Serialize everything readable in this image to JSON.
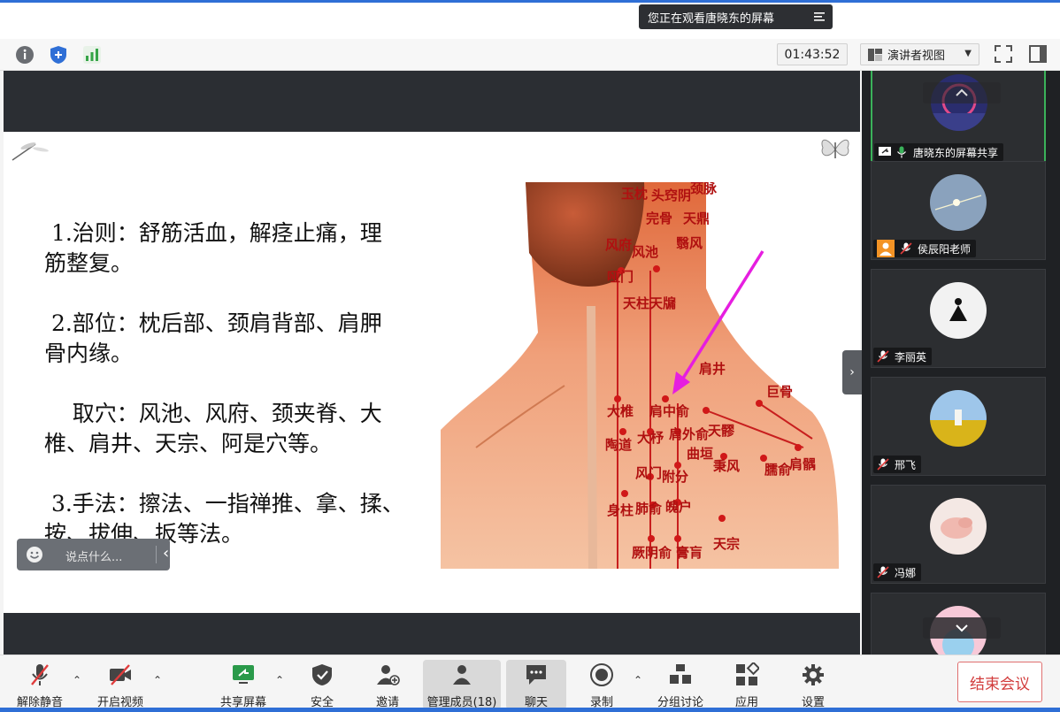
{
  "banner": {
    "text": "您正在观看唐晓东的屏幕"
  },
  "info_bar": {
    "timer": "01:43:52",
    "view_mode": "演讲者视图"
  },
  "slide": {
    "lines": [
      " 1.治则：舒筋活血，解痉止痛，理",
      "筋整复。",
      "",
      " 2.部位：枕后部、颈肩背部、肩胛",
      "骨内缘。",
      "",
      "    取穴：风池、风府、颈夹脊、大",
      "椎、肩井、天宗、阿是穴等。",
      "",
      " 3.手法：擦法、一指禅推、拿、揉、",
      "按、拔伸、扳等法。"
    ],
    "acupoints": [
      "玉枕",
      "头窍阴",
      "完骨",
      "翳风",
      "风府",
      "风池",
      "哑门",
      "天柱",
      "天牖",
      "天鼎",
      "肩井",
      "巨骨",
      "大椎",
      "肩中俞",
      "天髎",
      "陶道",
      "大杼",
      "肩外俞",
      "曲垣",
      "秉风",
      "臑俞",
      "肩髃",
      "风门",
      "附分",
      "身柱",
      "肺俞",
      "魄户",
      "厥阴俞",
      "膏肓",
      "天宗",
      "颈脉"
    ]
  },
  "chat": {
    "placeholder": "说点什么..."
  },
  "gallery": {
    "tiles": [
      {
        "name": "唐晓东的屏幕共享",
        "mic": "on",
        "sharing": true
      },
      {
        "name": "侯辰阳老师",
        "mic": "muted",
        "host": true
      },
      {
        "name": "李丽英",
        "mic": "muted"
      },
      {
        "name": "邢飞",
        "mic": "muted"
      },
      {
        "name": "冯娜",
        "mic": "muted"
      }
    ]
  },
  "toolbar": {
    "unmute": "解除静音",
    "start_video": "开启视频",
    "share_screen": "共享屏幕",
    "security": "安全",
    "invite": "邀请",
    "participants": "管理成员(18)",
    "chat": "聊天",
    "record": "录制",
    "breakout": "分组讨论",
    "apps": "应用",
    "settings": "设置",
    "end_meeting": "结束会议"
  },
  "colors": {
    "accent": "#2f6fd6",
    "end": "#d23c3c",
    "active_tile": "#3ab25a"
  }
}
